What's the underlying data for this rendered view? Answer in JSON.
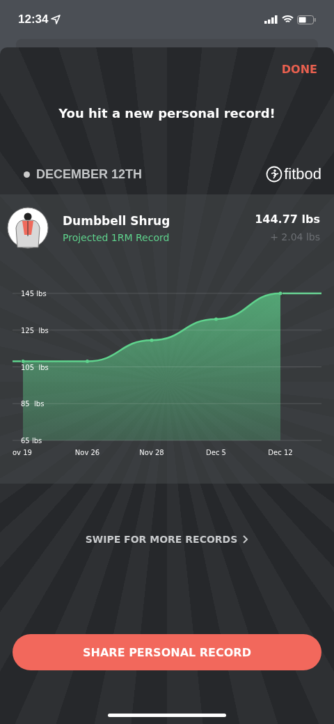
{
  "status_bar": {
    "time": "12:34"
  },
  "header": {
    "done": "DONE",
    "title": "You hit a new personal record!",
    "date": "DECEMBER 12TH",
    "brand": "fitbod"
  },
  "record": {
    "exercise": "Dumbbell Shrug",
    "record_type": "Projected 1RM Record",
    "value": "144.77 lbs",
    "delta": "+ 2.04 lbs",
    "chart_data": {
      "type": "area",
      "categories": [
        "ov 19",
        "Nov 26",
        "Nov 28",
        "Dec 5",
        "Dec 12"
      ],
      "series": [
        {
          "color": "#5fd38d",
          "values": [
            108,
            108,
            119.5,
            131,
            145
          ]
        }
      ],
      "grid": true,
      "ylim": [
        65,
        145
      ],
      "yticks": [
        {
          "value": 145,
          "label": "145 lbs"
        },
        {
          "value": 125,
          "label": "125  lbs"
        },
        {
          "value": 105,
          "label": "105  lbs"
        },
        {
          "value": 85,
          "label": "85  lbs"
        },
        {
          "value": 65,
          "label": "65 lbs"
        }
      ]
    }
  },
  "swipe": "SWIPE FOR MORE RECORDS",
  "share_button": "SHARE PERSONAL RECORD"
}
